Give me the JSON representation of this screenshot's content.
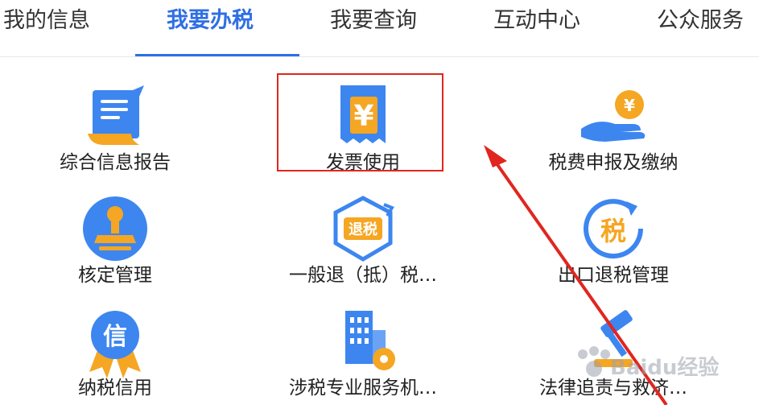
{
  "tabs": [
    {
      "label": "我的信息"
    },
    {
      "label": "我要办税"
    },
    {
      "label": "我要查询"
    },
    {
      "label": "互动中心"
    },
    {
      "label": "公众服务"
    }
  ],
  "services": [
    {
      "label": "综合信息报告",
      "icon": "report-document-icon"
    },
    {
      "label": "发票使用",
      "icon": "invoice-yuan-icon"
    },
    {
      "label": "税费申报及缴纳",
      "icon": "hand-coin-icon"
    },
    {
      "label": "核定管理",
      "icon": "stamp-icon"
    },
    {
      "label": "一般退（抵）税…",
      "icon": "tax-refund-icon"
    },
    {
      "label": "出口退税管理",
      "icon": "export-refund-icon"
    },
    {
      "label": "纳税信用",
      "icon": "credit-medal-icon"
    },
    {
      "label": "涉税专业服务机…",
      "icon": "building-gear-icon"
    },
    {
      "label": "法律追责与救济…",
      "icon": "legal-gavel-icon"
    }
  ],
  "watermark": {
    "text": "Baidu经验"
  },
  "colors": {
    "accent": "#2f6fe4",
    "highlight": "#e0261f",
    "icon_blue": "#3d86f0",
    "icon_orange": "#f5a623"
  }
}
